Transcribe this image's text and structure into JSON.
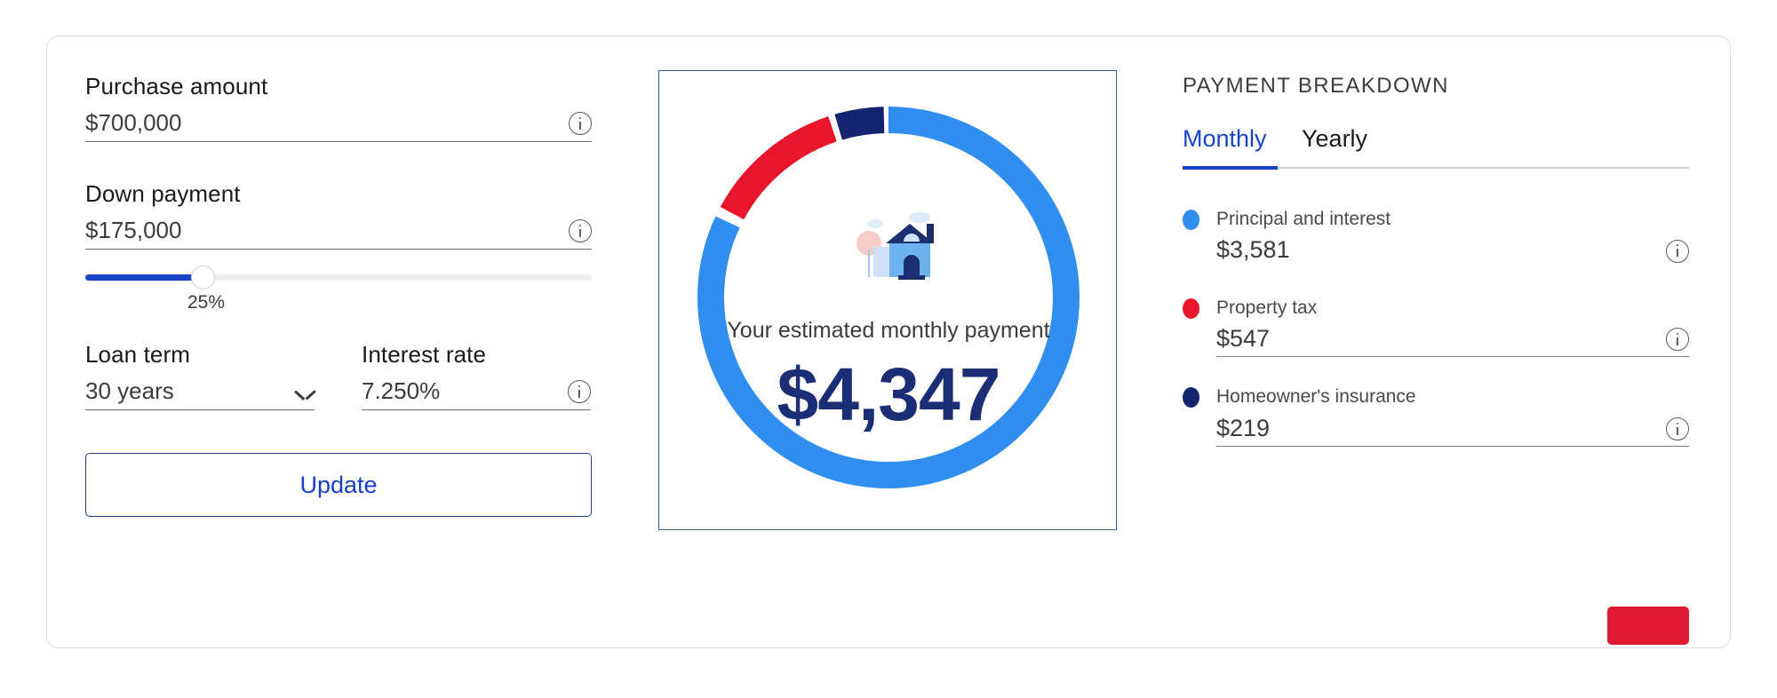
{
  "calculator": {
    "purchase_amount": {
      "label": "Purchase amount",
      "value": "$700,000",
      "info_icon": "info-icon"
    },
    "down_payment": {
      "label": "Down payment",
      "value": "$175,000",
      "info_icon": "info-icon",
      "slider_percent": "25%"
    },
    "loan_term": {
      "label": "Loan term",
      "value": "30 years",
      "chevron_icon": "chevron-down-icon"
    },
    "interest_rate": {
      "label": "Interest rate",
      "value": "7.250%",
      "info_icon": "info-icon"
    },
    "update_button": "Update"
  },
  "chart": {
    "caption": "Your estimated monthly payment",
    "amount": "$4,347",
    "illustration": "house-illustration"
  },
  "breakdown": {
    "title": "PAYMENT BREAKDOWN",
    "tabs": [
      {
        "label": "Monthly",
        "active": true
      },
      {
        "label": "Yearly",
        "active": false
      }
    ],
    "items": [
      {
        "label": "Principal and interest",
        "value": "$3,581",
        "color": "#2f8ef0",
        "ruled": false
      },
      {
        "label": "Property tax",
        "value": "$547",
        "color": "#e8152b",
        "ruled": true
      },
      {
        "label": "Homeowner's insurance",
        "value": "$219",
        "color": "#14246e",
        "ruled": true
      }
    ],
    "cta_label": ""
  },
  "chart_data": {
    "type": "pie",
    "title": "Your estimated monthly payment",
    "total": 4347,
    "total_label": "$4,347",
    "categories": [
      "Principal and interest",
      "Property tax",
      "Homeowner's insurance"
    ],
    "values": [
      3581,
      547,
      219
    ],
    "value_labels": [
      "$3,581",
      "$547",
      "$219"
    ],
    "percentages": [
      82.4,
      12.6,
      5.0
    ],
    "colors": [
      "#2f8ef0",
      "#e8152b",
      "#14246e"
    ],
    "legend": "right",
    "donut": true,
    "start_angle": -90,
    "direction": "clockwise"
  },
  "colors": {
    "accent_blue": "#1a43c8",
    "chart_blue": "#2f8ef0",
    "chart_red": "#e8152b",
    "chart_navy": "#14246e",
    "amount_navy": "#1a2d75",
    "cta_red": "#e01933"
  }
}
